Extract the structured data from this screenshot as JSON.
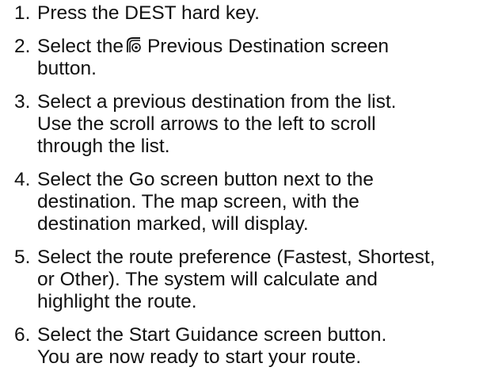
{
  "steps": [
    {
      "number": "1.",
      "lines": [
        "Press the DEST hard key."
      ]
    },
    {
      "number": "2.",
      "lines": [
        "Select the",
        "Previous Destination screen",
        "button."
      ],
      "icon": "previous-destination-icon"
    },
    {
      "number": "3.",
      "lines": [
        "Select a previous destination from the list.",
        "Use the scroll arrows to the left to scroll",
        "through the list."
      ]
    },
    {
      "number": "4.",
      "lines": [
        "Select the Go screen button next to the",
        "destination. The map screen, with the",
        "destination marked, will display."
      ]
    },
    {
      "number": "5.",
      "lines": [
        "Select the route preference (Fastest, Shortest,",
        "or Other). The system will calculate and",
        "highlight the route."
      ]
    },
    {
      "number": "6.",
      "lines": [
        "Select the Start Guidance screen button.",
        "You are now ready to start your route."
      ]
    }
  ]
}
